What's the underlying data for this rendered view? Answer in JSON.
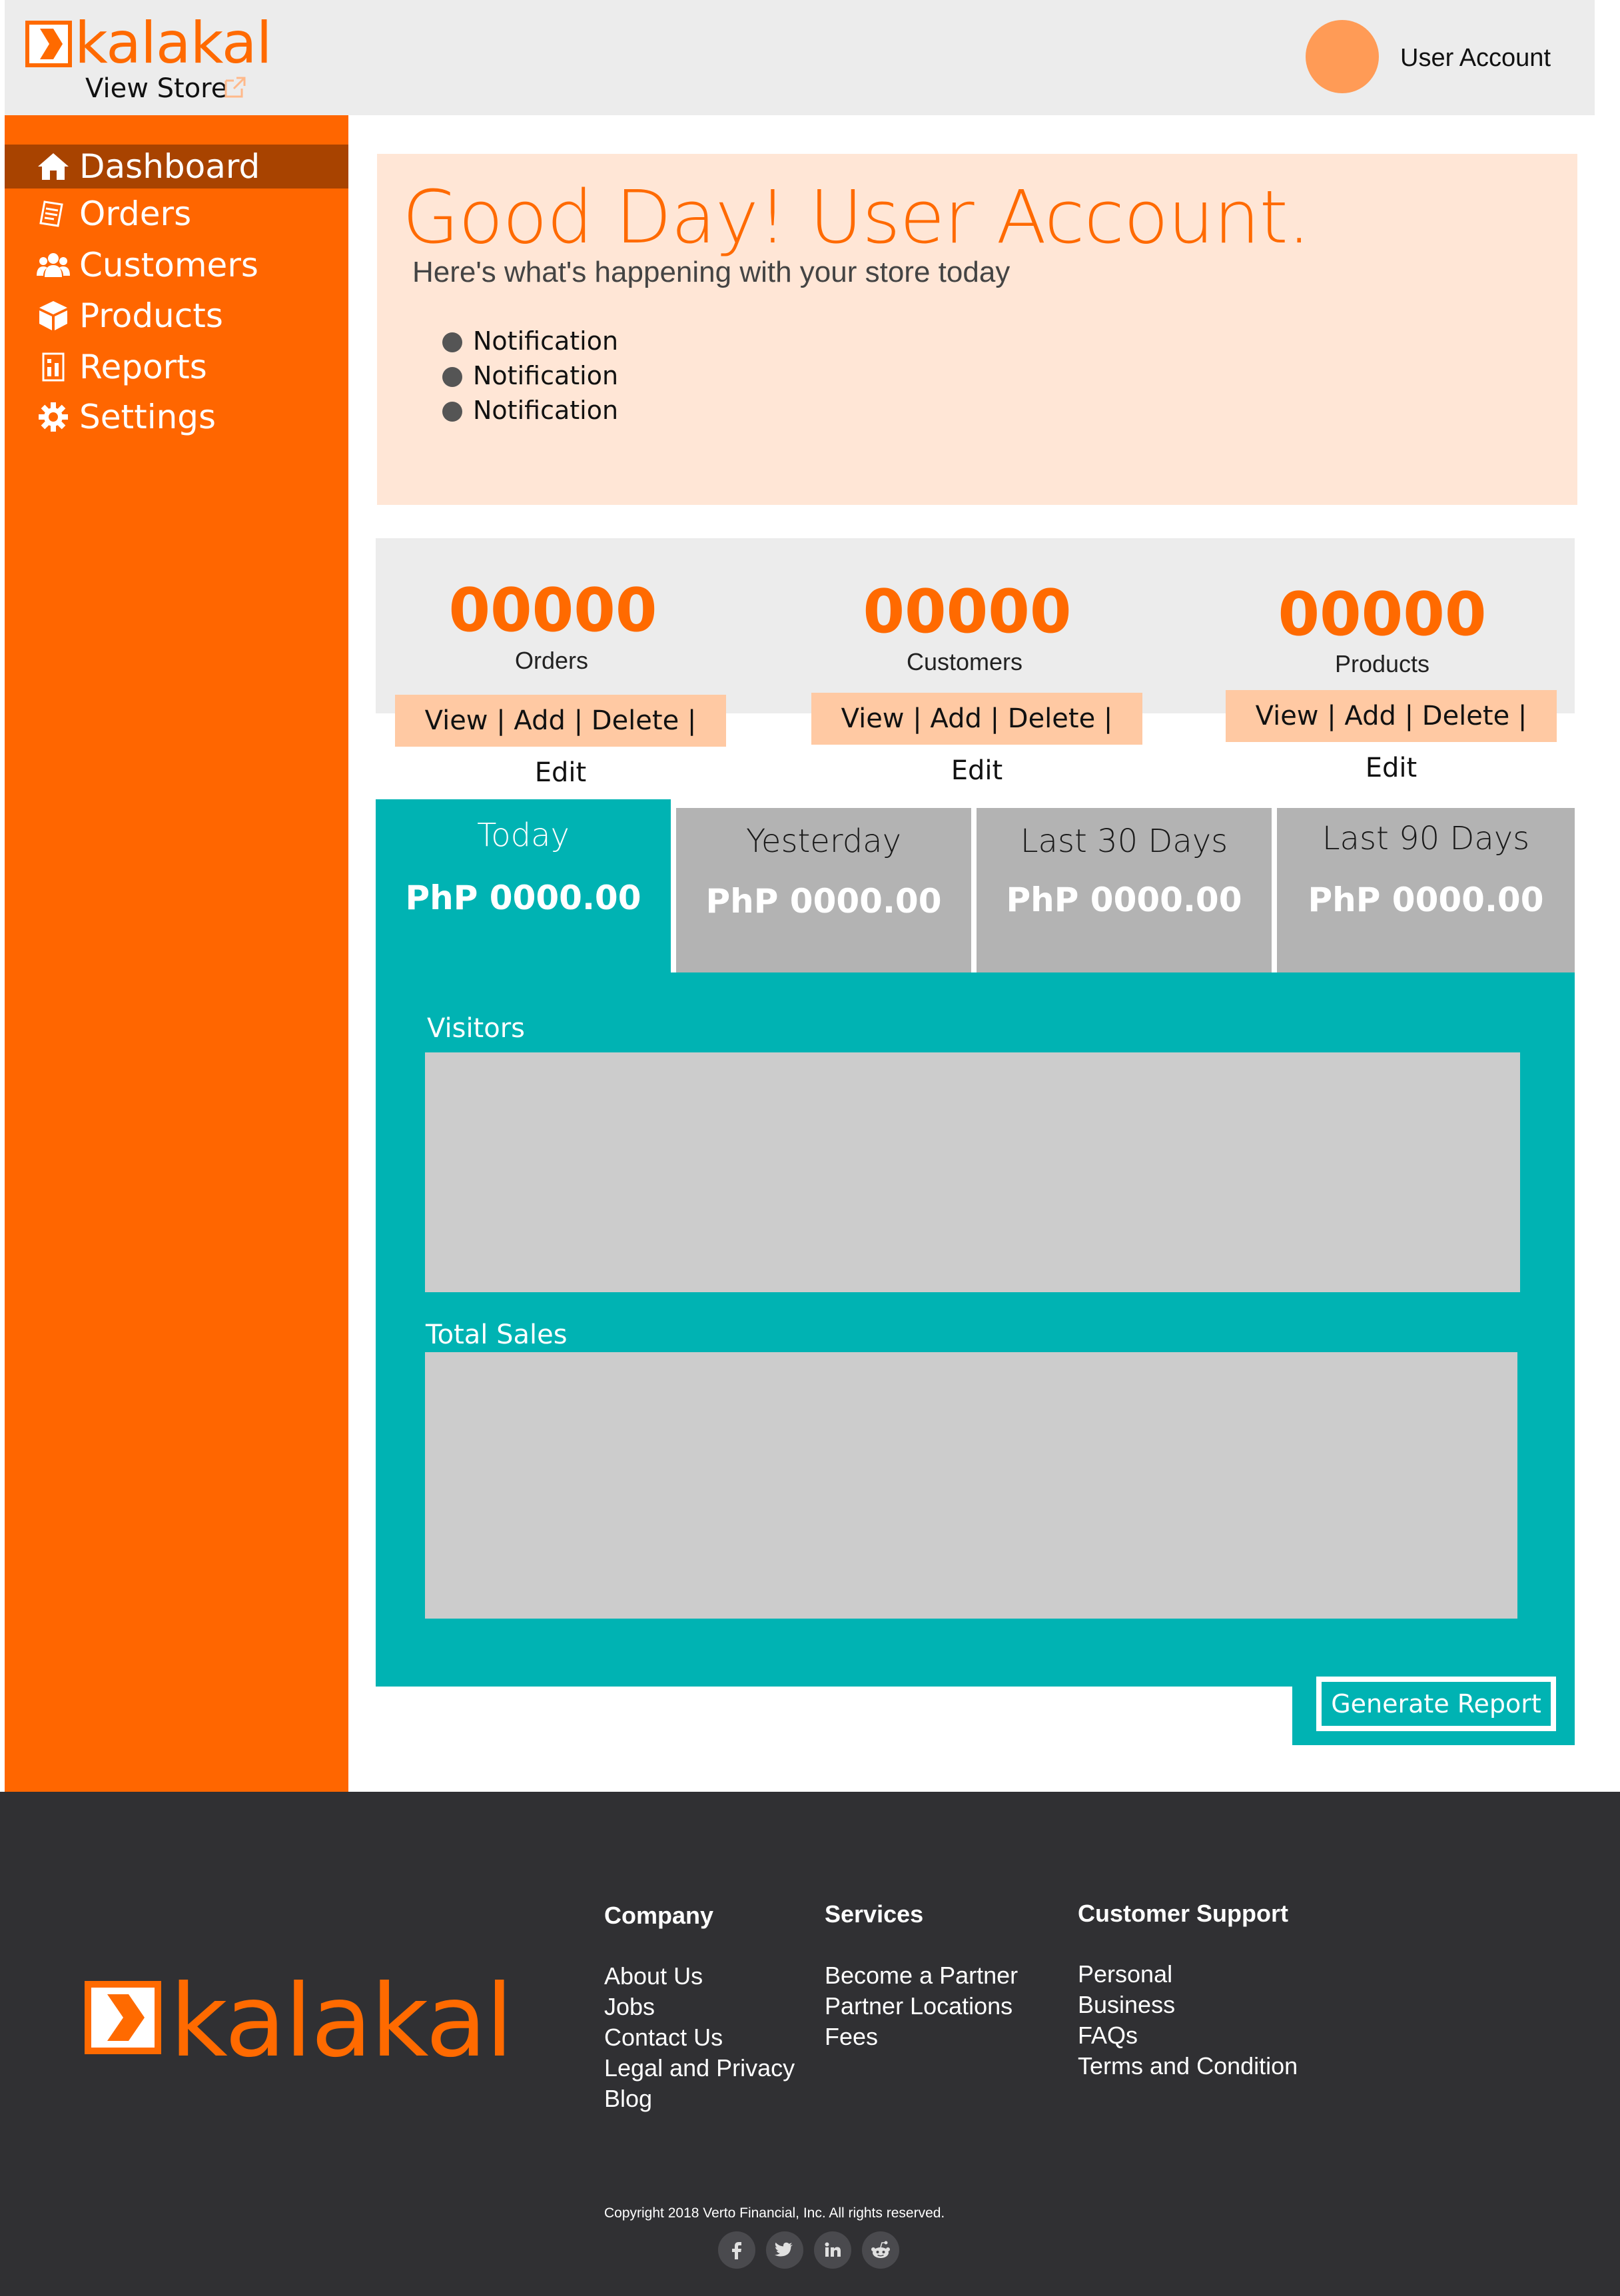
{
  "header": {
    "brand": "kalakal",
    "view_store": "View Store",
    "user_account": "User Account"
  },
  "sidebar": {
    "items": [
      {
        "label": "Dashboard",
        "icon": "home-icon",
        "active": true
      },
      {
        "label": "Orders",
        "icon": "receipt-icon"
      },
      {
        "label": "Customers",
        "icon": "users-icon"
      },
      {
        "label": "Products",
        "icon": "box-icon"
      },
      {
        "label": "Reports",
        "icon": "report-icon"
      },
      {
        "label": "Settings",
        "icon": "gear-icon"
      }
    ]
  },
  "greeting": {
    "title": "Good Day! User Account.",
    "subtitle": "Here's what's happening with your store today",
    "notifications": [
      "Notification",
      "Notification",
      "Notification"
    ]
  },
  "stats": [
    {
      "value": "00000",
      "label": "Orders",
      "actions": "View | Add | Delete | Edit"
    },
    {
      "value": "00000",
      "label": "Customers",
      "actions": "View | Add | Delete | Edit"
    },
    {
      "value": "00000",
      "label": "Products",
      "actions": "View | Add | Delete | Edit"
    }
  ],
  "tabs": [
    {
      "label": "Today",
      "amount": "PhP 0000.00",
      "active": true
    },
    {
      "label": "Yesterday",
      "amount": "PhP 0000.00"
    },
    {
      "label": "Last 30 Days",
      "amount": "PhP 0000.00"
    },
    {
      "label": "Last 90 Days",
      "amount": "PhP 0000.00"
    }
  ],
  "panel": {
    "visitors_label": "Visitors",
    "sales_label": "Total Sales",
    "generate_report": "Generate Report"
  },
  "footer": {
    "brand": "kalakal",
    "company": {
      "heading": "Company",
      "links": [
        "About Us",
        "Jobs",
        "Contact Us",
        "Legal and Privacy",
        "Blog"
      ]
    },
    "services": {
      "heading": "Services",
      "links": [
        "Become a Partner",
        "Partner Locations",
        "Fees"
      ]
    },
    "support": {
      "heading": "Customer Support",
      "links": [
        "Personal",
        "Business",
        "FAQs",
        "Terms and Condition"
      ]
    },
    "copyright": "Copyright 2018 Verto Financial, Inc. All rights reserved.",
    "social": [
      "facebook-icon",
      "twitter-icon",
      "linkedin-icon",
      "reddit-icon"
    ]
  },
  "colors": {
    "brand_orange": "#ff6600",
    "sidebar_active": "#a84300",
    "teal": "#00b3b3",
    "greeting_bg": "#ffe6d6",
    "action_bg": "#ffc9a3",
    "footer_bg": "#303033"
  }
}
